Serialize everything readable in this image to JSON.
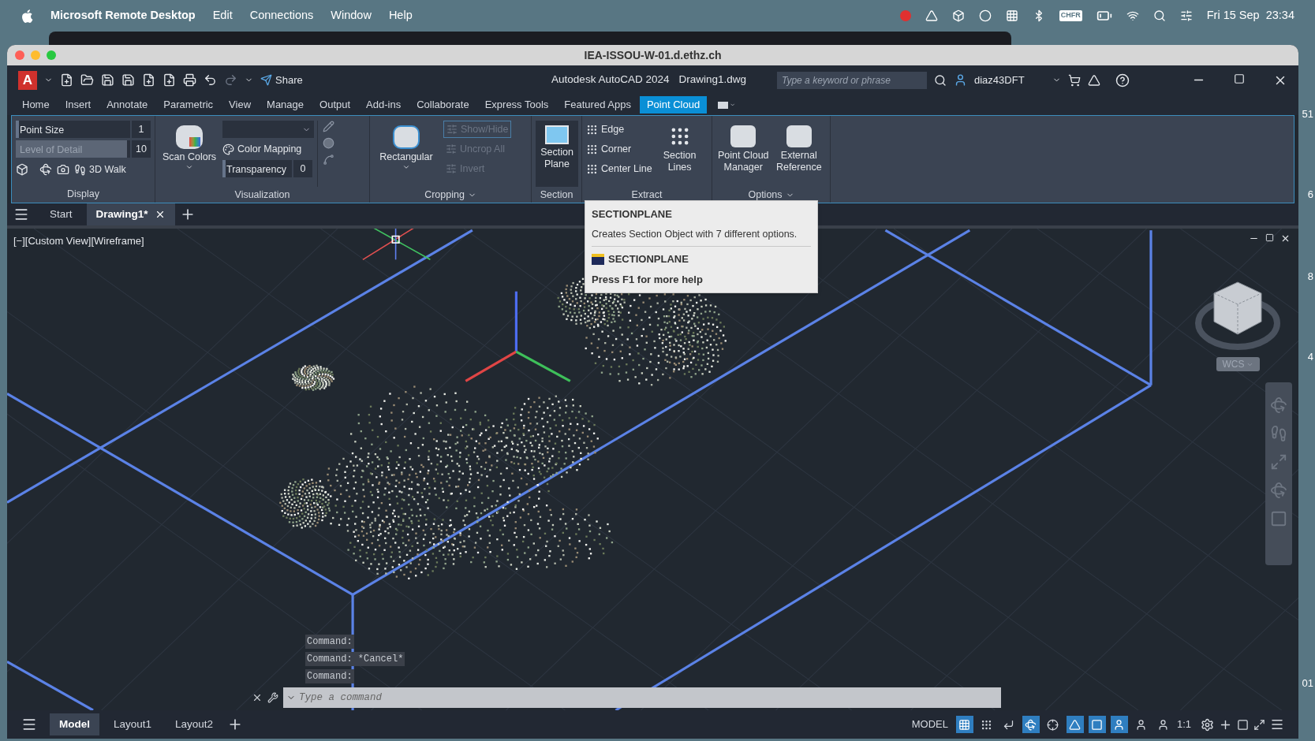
{
  "menu_bar": {
    "app": "Microsoft Remote Desktop",
    "items": [
      "Edit",
      "Connections",
      "Window",
      "Help"
    ],
    "input_source": "CHFR",
    "clock": "Fri 15 Sep  23:34"
  },
  "desktop_fragments": [
    "51",
    "6",
    "8",
    "4",
    "01"
  ],
  "window": {
    "title": "IEA-ISSOU-W-01.d.ethz.ch"
  },
  "app_bar": {
    "logo": "A",
    "share": "Share",
    "product": "Autodesk AutoCAD 2024",
    "file": "Drawing1.dwg",
    "search_placeholder": "Type a keyword or phrase",
    "user": "diaz43DFT"
  },
  "ribbon_tabs": [
    {
      "label": "Home",
      "selected": false
    },
    {
      "label": "Insert",
      "selected": false
    },
    {
      "label": "Annotate",
      "selected": false
    },
    {
      "label": "Parametric",
      "selected": false
    },
    {
      "label": "View",
      "selected": false
    },
    {
      "label": "Manage",
      "selected": false
    },
    {
      "label": "Output",
      "selected": false
    },
    {
      "label": "Add-ins",
      "selected": false
    },
    {
      "label": "Collaborate",
      "selected": false
    },
    {
      "label": "Express Tools",
      "selected": false
    },
    {
      "label": "Featured Apps",
      "selected": false
    },
    {
      "label": "Point Cloud",
      "selected": true
    }
  ],
  "ribbon_panels": [
    {
      "kind": "display",
      "title": "Display",
      "sliders": [
        {
          "label": "Point Size",
          "value": "1",
          "level": 0.03,
          "disabled": false
        },
        {
          "label": "Level of Detail",
          "value": "10",
          "level": 0.97,
          "disabled": true
        }
      ],
      "walk": "3D Walk"
    },
    {
      "kind": "visualization",
      "title": "Visualization",
      "scan_colors": "Scan Colors",
      "color_mapping": "Color Mapping",
      "transparency": {
        "label": "Transparency",
        "value": "0",
        "level": 0.04
      }
    },
    {
      "kind": "cropping",
      "title": "Cropping",
      "has_menu": true,
      "main": "Rectangular",
      "buttons": [
        {
          "label": "Show/Hide",
          "disabled": true
        },
        {
          "label": "Uncrop All",
          "disabled": true
        },
        {
          "label": "Invert",
          "disabled": true
        }
      ]
    },
    {
      "kind": "section",
      "title": "Section",
      "button": "Section Plane",
      "hovered": true
    },
    {
      "kind": "extract",
      "title": "Extract",
      "buttons": [
        "Edge",
        "Corner",
        "Center Line"
      ],
      "big": "Section Lines"
    },
    {
      "kind": "options",
      "title": "Options",
      "has_menu": true,
      "buttons": [
        "Point Cloud Manager",
        "External Reference"
      ]
    }
  ],
  "doc_tabs": [
    {
      "label": "Start",
      "selected": false
    },
    {
      "label": "Drawing1*",
      "selected": true
    }
  ],
  "viewport": {
    "label": "[−][Custom View][Wireframe]",
    "wcs": "WCS",
    "history": [
      "Command:",
      "Command: *Cancel*",
      "Command:"
    ],
    "command_placeholder": "Type a command"
  },
  "tooltip": {
    "title": "SECTIONPLANE",
    "description": "Creates Section Object with 7 different options.",
    "command": "SECTIONPLANE",
    "help": "Press F1 for more help"
  },
  "layout_tabs": [
    {
      "label": "Model",
      "selected": true
    },
    {
      "label": "Layout1",
      "selected": false
    },
    {
      "label": "Layout2",
      "selected": false
    }
  ],
  "status_bar": {
    "model": "MODEL",
    "scale": "1:1",
    "toggles": [
      {
        "on": true
      },
      {
        "on": false
      },
      {
        "on": false
      },
      {
        "on": true
      },
      {
        "on": false
      },
      {
        "on": true
      },
      {
        "on": true
      },
      {
        "on": true
      },
      {
        "on": false
      },
      {
        "on": false
      }
    ]
  }
}
